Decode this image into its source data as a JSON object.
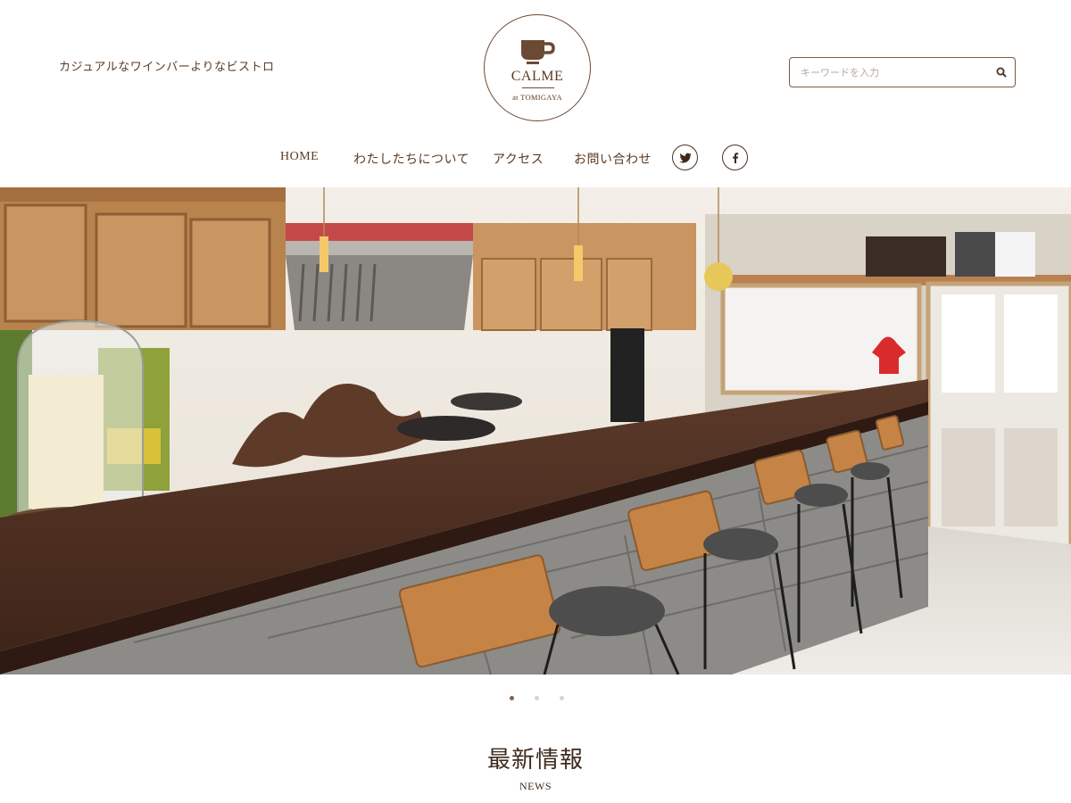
{
  "header": {
    "tagline": "カジュアルなワインバーよりなビストロ",
    "logo": {
      "name": "CALME",
      "sub": "at TOMIGAYA",
      "icon": "coffee-cup-icon"
    },
    "search": {
      "placeholder": "キーワードを入力",
      "value": "",
      "icon": "search-icon"
    }
  },
  "nav": {
    "items": [
      {
        "label": "HOME"
      },
      {
        "label": "わたしたちについて"
      },
      {
        "label": "アクセス"
      },
      {
        "label": "お問い合わせ"
      }
    ],
    "social": [
      {
        "icon": "twitter-icon"
      },
      {
        "icon": "facebook-icon"
      }
    ]
  },
  "hero": {
    "slider": {
      "current": 1,
      "total": 3
    }
  },
  "news": {
    "title": "最新情報",
    "subtitle": "NEWS"
  },
  "colors": {
    "brand_brown": "#5b3b24",
    "dot_active": "#8a6244",
    "dot_inactive": "#d8d3ce"
  }
}
